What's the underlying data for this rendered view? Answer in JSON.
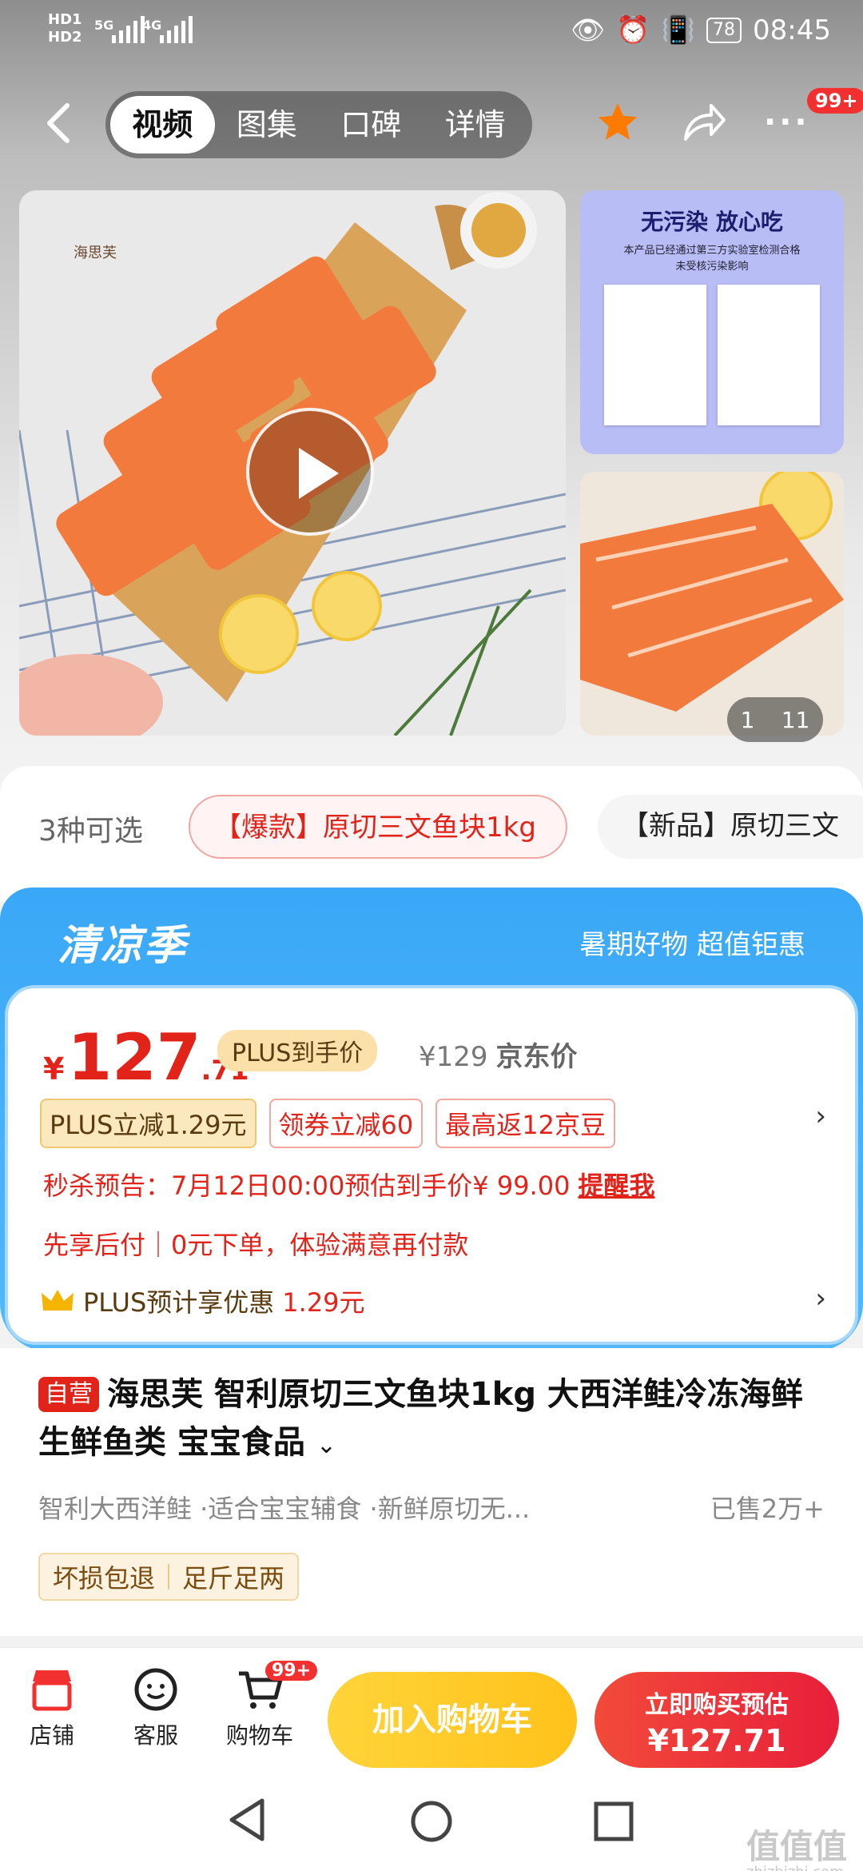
{
  "status_bar": {
    "hd1": "HD1",
    "hd2": "HD2",
    "net1": "5G",
    "net2": "4G",
    "battery": "78",
    "time": "08:45"
  },
  "nav": {
    "tabs": [
      "视频",
      "图集",
      "口碑",
      "详情"
    ],
    "active_tab": 0,
    "more_badge": "99+"
  },
  "gallery": {
    "brand_logo_text": "海思芙",
    "cert_title": "无污染  放心吃",
    "cert_subtitle_1": "本产品已经通过第三方实验室检测合格",
    "cert_subtitle_2": "未受核污染影响",
    "page_current": "1",
    "page_total": "11"
  },
  "sku": {
    "count_label": "3种可选",
    "selected": "【爆款】原切三文鱼块1kg",
    "other": "【新品】原切三文"
  },
  "banner": {
    "title": "清凉季",
    "subtitle": "暑期好物 超值钜惠"
  },
  "price": {
    "currency": "¥",
    "integer": "127",
    "decimal": ".71",
    "plus_tag": "PLUS到手价",
    "jd_price": "¥129",
    "jd_price_label": "京东价",
    "chips": [
      "PLUS立减1.29元",
      "领券立减60",
      "最高返12京豆"
    ],
    "seckill_text": "秒杀预告：7月12日00:00预估到手价¥ 99.00",
    "seckill_remind": "提醒我",
    "paylater": "先享后付｜0元下单，体验满意再付款",
    "plus_saving_prefix": "PLUS预计享优惠",
    "plus_saving_value": "1.29元"
  },
  "product": {
    "self_tag": "自营",
    "title": "海思芙 智利原切三文鱼块1kg  大西洋鲑冷冻海鲜 生鲜鱼类 宝宝食品",
    "features": "智利大西洋鲑 ·适合宝宝辅食 ·新鲜原切无...",
    "sold": "已售2万+",
    "guarantees": [
      "坏损包退",
      "足斤足两"
    ]
  },
  "bottom_bar": {
    "store": "店铺",
    "service": "客服",
    "cart": "购物车",
    "cart_badge": "99+",
    "add_cart": "加入购物车",
    "buy_line1": "立即购买预估",
    "buy_line2": "¥127.71"
  },
  "watermark": {
    "text": "值值值",
    "site": "zhizhizhi.com"
  },
  "colors": {
    "price_red": "#e2231a",
    "banner_blue": "#3aa8f7",
    "add_cart_yellow": "#ffc21a",
    "buy_red": "#e81f3a"
  }
}
